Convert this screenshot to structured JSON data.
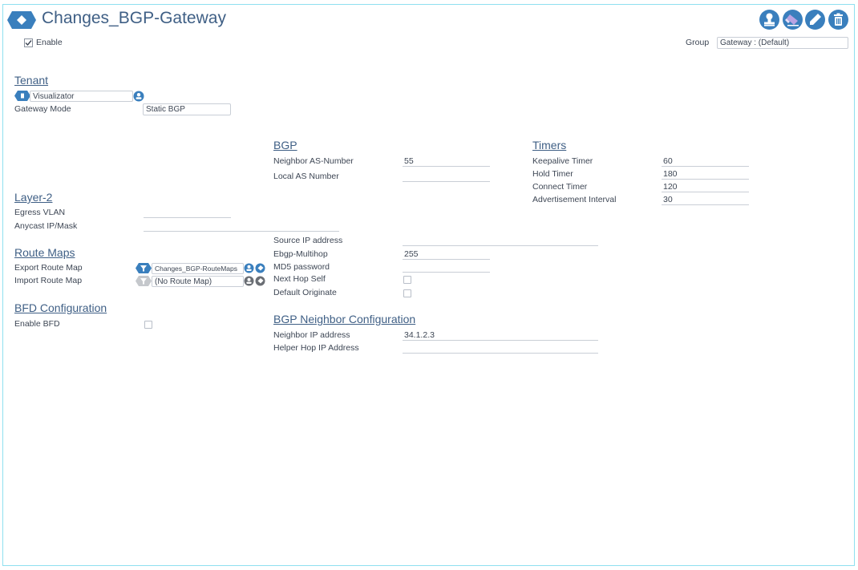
{
  "header": {
    "title": "Changes_BGP-Gateway",
    "enable_label": "Enable",
    "enable_checked": true,
    "group_label": "Group",
    "group_value": "Gateway : (Default)",
    "toolbar_icons": [
      "user-stamp-icon",
      "eraser-icon",
      "pencil-icon",
      "trash-icon"
    ]
  },
  "tenant": {
    "heading": "Tenant",
    "tenant_value": "Visualizator",
    "gateway_mode_label": "Gateway Mode",
    "gateway_mode_value": "Static BGP"
  },
  "layer2": {
    "heading": "Layer-2",
    "egress_vlan_label": "Egress VLAN",
    "anycast_label": "Anycast IP/Mask"
  },
  "route_maps": {
    "heading": "Route Maps",
    "export_label": "Export Route Map",
    "export_value": "Changes_BGP-RouteMaps",
    "import_label": "Import Route Map",
    "import_value": "(No Route Map)"
  },
  "bfd": {
    "heading": "BFD Configuration",
    "enable_bfd_label": "Enable BFD"
  },
  "bgp": {
    "heading": "BGP",
    "neighbor_as_label": "Neighbor AS-Number",
    "neighbor_as_value": "55",
    "local_as_label": "Local AS Number",
    "source_ip_label": "Source IP address",
    "multihop_label": "Ebgp-Multihop",
    "multihop_value": "255",
    "md5_label": "MD5 password",
    "next_hop_self_label": "Next Hop Self",
    "default_originate_label": "Default Originate"
  },
  "timers": {
    "heading": "Timers",
    "keepalive_label": "Keepalive Timer",
    "keepalive_value": "60",
    "hold_label": "Hold Timer",
    "hold_value": "180",
    "connect_label": "Connect Timer",
    "connect_value": "120",
    "advert_label": "Advertisement Interval",
    "advert_value": "30"
  },
  "neighbor": {
    "heading": "BGP Neighbor Configuration",
    "neighbor_ip_label": "Neighbor IP address",
    "neighbor_ip_value": "34.1.2.3",
    "helper_hop_label": "Helper Hop IP Address"
  },
  "colors": {
    "accent": "#3a7fbd",
    "heading": "#3f5f85",
    "frame": "#8fe0f0",
    "disabled": "#c5c8cc"
  }
}
